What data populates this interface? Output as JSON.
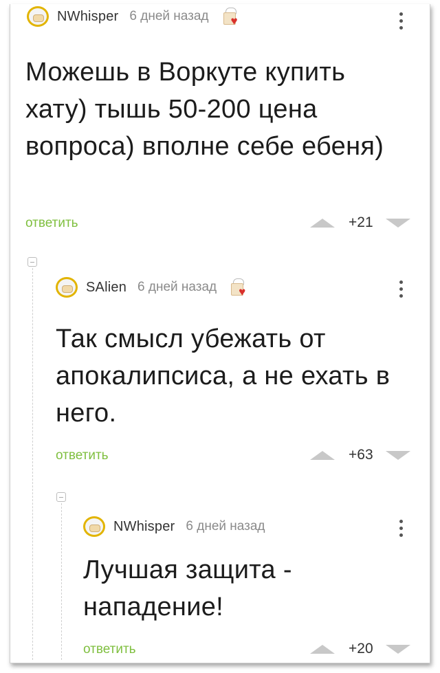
{
  "comments": [
    {
      "author": "NWhisper",
      "time": "6 дней назад",
      "text": "Можешь в Воркуте купить хату) тышь 50-200 цена вопроса) вполне себе ебеня)",
      "reply_label": "ответить",
      "score": "+21"
    },
    {
      "author": "SAlien",
      "time": "6 дней назад",
      "text": "Так смысл убежать от апокалипсиса, а не ехать в него.",
      "reply_label": "ответить",
      "score": "+63"
    },
    {
      "author": "NWhisper",
      "time": "6 дней назад",
      "text": "Лучшая защита - нападение!",
      "reply_label": "ответить",
      "score": "+20"
    }
  ],
  "colors": {
    "reply_link": "#7fbf3f",
    "vote_arrow": "#c8c8c8",
    "avatar_ring": "#e2b400",
    "heart": "#d9302b"
  },
  "icons": [
    "avatar-icon",
    "award-heart-icon",
    "more-options-icon",
    "upvote-icon",
    "downvote-icon",
    "collapse-thread-icon"
  ]
}
